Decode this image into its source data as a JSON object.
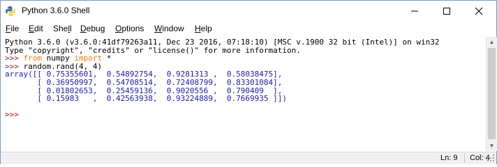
{
  "window": {
    "title": "Python 3.6.0 Shell"
  },
  "controls": {
    "minimize": "—",
    "maximize": "☐",
    "close": "✕"
  },
  "menu": [
    {
      "pre": "",
      "key": "F",
      "post": "ile"
    },
    {
      "pre": "",
      "key": "E",
      "post": "dit"
    },
    {
      "pre": "She",
      "key": "l",
      "post": "l"
    },
    {
      "pre": "",
      "key": "D",
      "post": "ebug"
    },
    {
      "pre": "",
      "key": "O",
      "post": "ptions"
    },
    {
      "pre": "",
      "key": "W",
      "post": "indow"
    },
    {
      "pre": "",
      "key": "H",
      "post": "elp"
    }
  ],
  "shell": {
    "banner1": "Python 3.6.0 (v3.6.0:41df79263a11, Dec 23 2016, 07:18:10) [MSC v.1900 32 bit (Intel)] on win32",
    "banner2": "Type \"copyright\", \"credits\" or \"license()\" for more information.",
    "prompt": ">>> ",
    "cmd1_kw1": "from",
    "cmd1_mid": " numpy ",
    "cmd1_kw2": "import",
    "cmd1_end": " *",
    "cmd2": "random.rand(4, 4)",
    "out1": "array([[ 0.75355601,  0.54892754,  0.9281313 ,  0.58038475],",
    "out2": "       [ 0.36950997,  0.54708514,  0.72408799,  0.83301084],",
    "out3": "       [ 0.01802653,  0.25459136,  0.9020556 ,  0.790409  ],",
    "out4": "       [ 0.15983   ,  0.42563938,  0.93224889,  0.7669935 ]])",
    "prompt_final": ">>> "
  },
  "status": {
    "line": "Ln: 9",
    "col": "Col: 4"
  }
}
